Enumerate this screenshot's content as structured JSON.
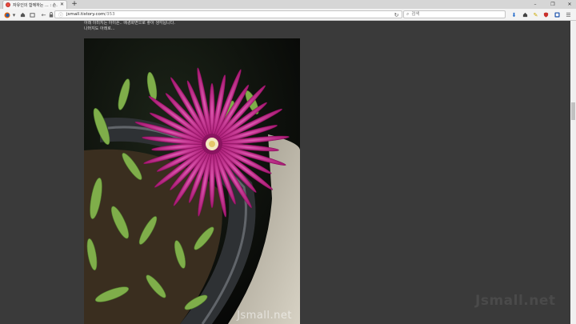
{
  "browser": {
    "tab": {
      "title": "자유인의 함께하는 ... : 손...",
      "close_glyph": "✕"
    },
    "new_tab_glyph": "+",
    "window_controls": [
      "–",
      "❐",
      "✕"
    ],
    "toolbar_icons": [
      "firefox-logo-icon",
      "chevron-down-icon",
      "home-icon",
      "back-icon",
      "forward-icon",
      "lock-icon"
    ],
    "url": {
      "host": "jsmall.tistory.com",
      "path": "/353"
    },
    "search": {
      "placeholder": "검색"
    },
    "right_icons": [
      "reload-icon",
      "download-icon",
      "home-icon",
      "bookmark-icon",
      "shield-icon",
      "extension-icon",
      "menu-icon"
    ]
  },
  "page": {
    "text_line_1": "아래 이미지는 아이폰.. 배경화면으로 좋아 생각됩니다.",
    "text_line_2": "나머지도 아래로...",
    "photo_watermark": "Jsmall.net",
    "page_watermark": "Jsmall.net"
  },
  "colors": {
    "page_bg": "#3a3a3a",
    "flower": "#b2177c",
    "flower_center": "#f4e9c1"
  }
}
